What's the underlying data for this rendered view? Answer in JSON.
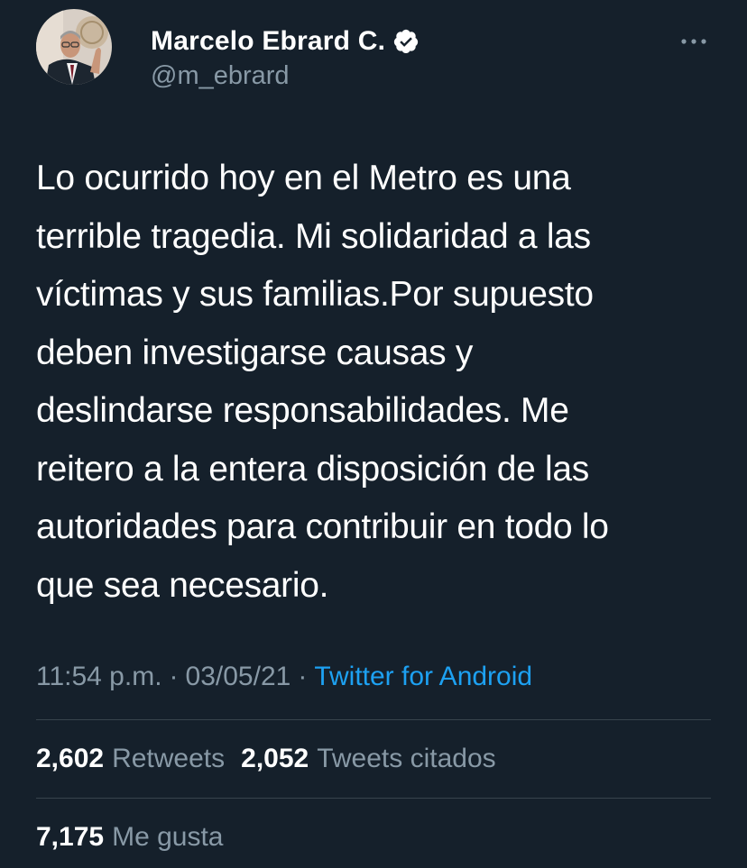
{
  "colors": {
    "background": "#15202b",
    "text_primary": "#ffffff",
    "text_secondary": "#8899a6",
    "link": "#1da1f2",
    "divider": "#38444d"
  },
  "author": {
    "display_name": "Marcelo Ebrard C.",
    "handle": "@m_ebrard",
    "verified": true,
    "verified_icon": "verified-badge-icon",
    "avatar_icon": "avatar-photo"
  },
  "actions": {
    "more_icon": "more-dots-icon"
  },
  "tweet": {
    "text": "Lo ocurrido hoy en el Metro es una\nterrible tragedia. Mi solidaridad a las\nvíctimas y sus familias.Por supuesto\ndeben investigarse causas y\ndeslindarse responsabilidades. Me\nreitero a la entera disposición de las\nautoridades para contribuir en todo lo\nque sea necesario.",
    "time": "11:54 p.m.",
    "date": "03/05/21",
    "separator": "·",
    "source": "Twitter for Android"
  },
  "stats": {
    "retweets_count": "2,602",
    "retweets_label": "Retweets",
    "quotes_count": "2,052",
    "quotes_label": "Tweets citados",
    "likes_count": "7,175",
    "likes_label": "Me gusta"
  }
}
